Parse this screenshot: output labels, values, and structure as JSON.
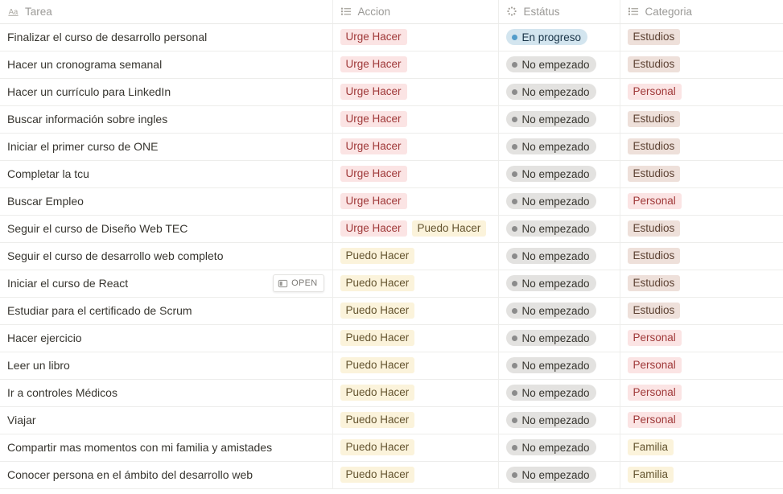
{
  "table": {
    "columns": [
      {
        "id": "tarea",
        "label": "Tarea",
        "icon": "title-aa-icon",
        "type": "title"
      },
      {
        "id": "accion",
        "label": "Accion",
        "icon": "multi-select-list-icon",
        "type": "multi-select"
      },
      {
        "id": "estatus",
        "label": "Estátus",
        "icon": "status-spinner-icon",
        "type": "status"
      },
      {
        "id": "categoria",
        "label": "Categoria",
        "icon": "multi-select-list-icon",
        "type": "multi-select"
      }
    ],
    "open_button_label": "OPEN",
    "rows": [
      {
        "tarea": "Finalizar el curso de desarrollo personal",
        "accion": [
          {
            "label": "Urge Hacer",
            "color": "red"
          }
        ],
        "estatus": {
          "label": "En progreso",
          "color": "blue"
        },
        "categoria": [
          {
            "label": "Estudios",
            "color": "brown"
          }
        ],
        "has_open_button": false
      },
      {
        "tarea": "Hacer un cronograma semanal",
        "accion": [
          {
            "label": "Urge Hacer",
            "color": "red"
          }
        ],
        "estatus": {
          "label": "No empezado",
          "color": "gray"
        },
        "categoria": [
          {
            "label": "Estudios",
            "color": "brown"
          }
        ],
        "has_open_button": false
      },
      {
        "tarea": "Hacer un currículo para LinkedIn",
        "accion": [
          {
            "label": "Urge Hacer",
            "color": "red"
          }
        ],
        "estatus": {
          "label": "No empezado",
          "color": "gray"
        },
        "categoria": [
          {
            "label": "Personal",
            "color": "red"
          }
        ],
        "has_open_button": false
      },
      {
        "tarea": "Buscar información sobre ingles",
        "accion": [
          {
            "label": "Urge Hacer",
            "color": "red"
          }
        ],
        "estatus": {
          "label": "No empezado",
          "color": "gray"
        },
        "categoria": [
          {
            "label": "Estudios",
            "color": "brown"
          }
        ],
        "has_open_button": false
      },
      {
        "tarea": "Iniciar el primer curso de ONE",
        "accion": [
          {
            "label": "Urge Hacer",
            "color": "red"
          }
        ],
        "estatus": {
          "label": "No empezado",
          "color": "gray"
        },
        "categoria": [
          {
            "label": "Estudios",
            "color": "brown"
          }
        ],
        "has_open_button": false
      },
      {
        "tarea": "Completar la tcu",
        "accion": [
          {
            "label": "Urge Hacer",
            "color": "red"
          }
        ],
        "estatus": {
          "label": "No empezado",
          "color": "gray"
        },
        "categoria": [
          {
            "label": "Estudios",
            "color": "brown"
          }
        ],
        "has_open_button": false
      },
      {
        "tarea": "Buscar Empleo",
        "accion": [
          {
            "label": "Urge Hacer",
            "color": "red"
          }
        ],
        "estatus": {
          "label": "No empezado",
          "color": "gray"
        },
        "categoria": [
          {
            "label": "Personal",
            "color": "red"
          }
        ],
        "has_open_button": false
      },
      {
        "tarea": "Seguir el curso de Diseño Web TEC",
        "accion": [
          {
            "label": "Urge Hacer",
            "color": "red"
          },
          {
            "label": "Puedo Hacer",
            "color": "yellow"
          }
        ],
        "estatus": {
          "label": "No empezado",
          "color": "gray"
        },
        "categoria": [
          {
            "label": "Estudios",
            "color": "brown"
          }
        ],
        "has_open_button": false
      },
      {
        "tarea": "Seguir el curso de desarrollo web completo",
        "accion": [
          {
            "label": "Puedo Hacer",
            "color": "yellow"
          }
        ],
        "estatus": {
          "label": "No empezado",
          "color": "gray"
        },
        "categoria": [
          {
            "label": "Estudios",
            "color": "brown"
          }
        ],
        "has_open_button": false
      },
      {
        "tarea": "Iniciar el curso de React",
        "accion": [
          {
            "label": "Puedo Hacer",
            "color": "yellow"
          }
        ],
        "estatus": {
          "label": "No empezado",
          "color": "gray"
        },
        "categoria": [
          {
            "label": "Estudios",
            "color": "brown"
          }
        ],
        "has_open_button": true
      },
      {
        "tarea": "Estudiar para el certificado de Scrum",
        "accion": [
          {
            "label": "Puedo Hacer",
            "color": "yellow"
          }
        ],
        "estatus": {
          "label": "No empezado",
          "color": "gray"
        },
        "categoria": [
          {
            "label": "Estudios",
            "color": "brown"
          }
        ],
        "has_open_button": false
      },
      {
        "tarea": "Hacer ejercicio",
        "accion": [
          {
            "label": "Puedo Hacer",
            "color": "yellow"
          }
        ],
        "estatus": {
          "label": "No empezado",
          "color": "gray"
        },
        "categoria": [
          {
            "label": "Personal",
            "color": "red"
          }
        ],
        "has_open_button": false
      },
      {
        "tarea": "Leer un libro",
        "accion": [
          {
            "label": "Puedo Hacer",
            "color": "yellow"
          }
        ],
        "estatus": {
          "label": "No empezado",
          "color": "gray"
        },
        "categoria": [
          {
            "label": "Personal",
            "color": "red"
          }
        ],
        "has_open_button": false
      },
      {
        "tarea": "Ir a controles Médicos",
        "accion": [
          {
            "label": "Puedo Hacer",
            "color": "yellow"
          }
        ],
        "estatus": {
          "label": "No empezado",
          "color": "gray"
        },
        "categoria": [
          {
            "label": "Personal",
            "color": "red"
          }
        ],
        "has_open_button": false
      },
      {
        "tarea": "Viajar",
        "accion": [
          {
            "label": "Puedo Hacer",
            "color": "yellow"
          }
        ],
        "estatus": {
          "label": "No empezado",
          "color": "gray"
        },
        "categoria": [
          {
            "label": "Personal",
            "color": "red"
          }
        ],
        "has_open_button": false
      },
      {
        "tarea": "Compartir mas momentos con mi familia y amistades",
        "accion": [
          {
            "label": "Puedo Hacer",
            "color": "yellow"
          }
        ],
        "estatus": {
          "label": "No empezado",
          "color": "gray"
        },
        "categoria": [
          {
            "label": "Familia",
            "color": "yellow"
          }
        ],
        "has_open_button": false
      },
      {
        "tarea": "Conocer persona en el ámbito del desarrollo web",
        "accion": [
          {
            "label": "Puedo Hacer",
            "color": "yellow"
          }
        ],
        "estatus": {
          "label": "No empezado",
          "color": "gray"
        },
        "categoria": [
          {
            "label": "Familia",
            "color": "yellow"
          }
        ],
        "has_open_button": false
      }
    ]
  },
  "colors": {
    "pill_red_bg": "#fbe4e4",
    "pill_red_fg": "#9f3838",
    "pill_yellow_bg": "#fbf3db",
    "pill_yellow_fg": "#64542f",
    "pill_brown_bg": "#eee0da",
    "pill_brown_fg": "#5d4233",
    "status_gray_bg": "#e3e2e0",
    "status_gray_dot": "#8b8b8b",
    "status_blue_bg": "#d3e5ef",
    "status_blue_dot": "#529cca",
    "border": "#ededeb",
    "header_text": "#9b9a97",
    "body_text": "#37352f"
  }
}
